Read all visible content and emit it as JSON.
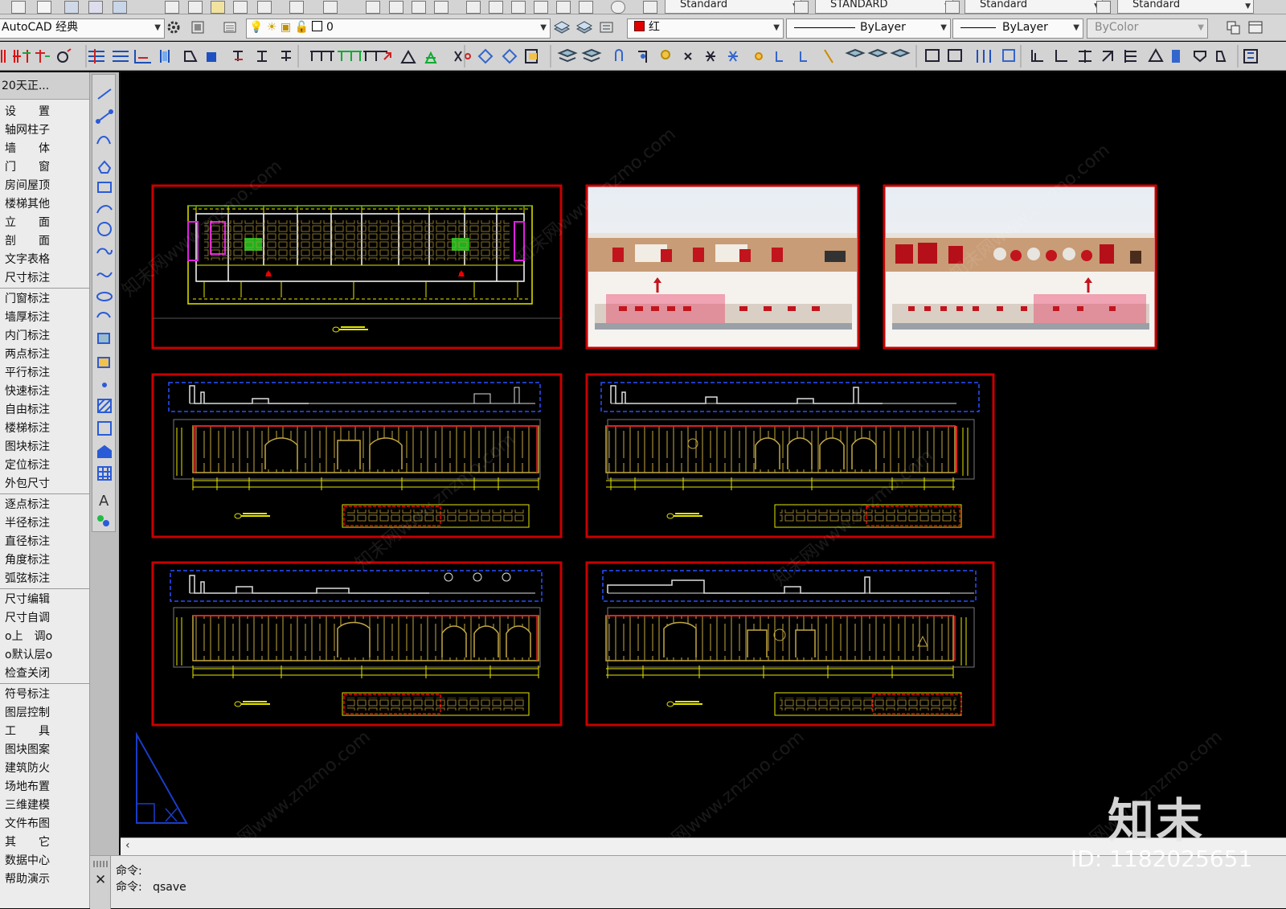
{
  "toolbar_top": {
    "text_style": "Standard",
    "dim_style": "STANDARD",
    "table_style": "Standard",
    "mleader_style": "Standard"
  },
  "toolbar_props": {
    "workspace": "AutoCAD 经典",
    "layer": "0",
    "color": "红",
    "color_hex": "#e00000",
    "linetype": "ByLayer",
    "lineweight": "ByLayer",
    "plotstyle": "ByColor"
  },
  "tz_menu": {
    "title": "20天正...",
    "items": [
      "设　　置",
      "轴网柱子",
      "墙　　体",
      "门　　窗",
      "房间屋顶",
      "楼梯其他",
      "立　　面",
      "剖　　面",
      "文字表格",
      "尺寸标注",
      "门窗标注",
      "墙厚标注",
      "内门标注",
      "两点标注",
      "平行标注",
      "快速标注",
      "自由标注",
      "楼梯标注",
      "图块标注",
      "定位标注",
      "外包尺寸",
      "逐点标注",
      "半径标注",
      "直径标注",
      "角度标注",
      "弧弦标注",
      "尺寸编辑",
      "尺寸自调",
      "o上　调o",
      "o默认层o",
      "检查关闭",
      "符号标注",
      "图层控制",
      "工　　具",
      "图块图案",
      "建筑防火",
      "场地布置",
      "三维建模",
      "文件布图",
      "其　　它",
      "数据中心",
      "帮助演示"
    ]
  },
  "command": {
    "line1": "命令:",
    "line2_prefix": "命令:",
    "line2_cmd": "qsave"
  },
  "watermark": {
    "brand": "知末",
    "id_text": "ID: 1182025651",
    "url_text": "知末网www.znzmo.com"
  },
  "colors": {
    "frame_red": "#c80000",
    "cad_yellow": "#e6e600",
    "cad_blue": "#2850ff",
    "canvas_bg": "#000000"
  }
}
